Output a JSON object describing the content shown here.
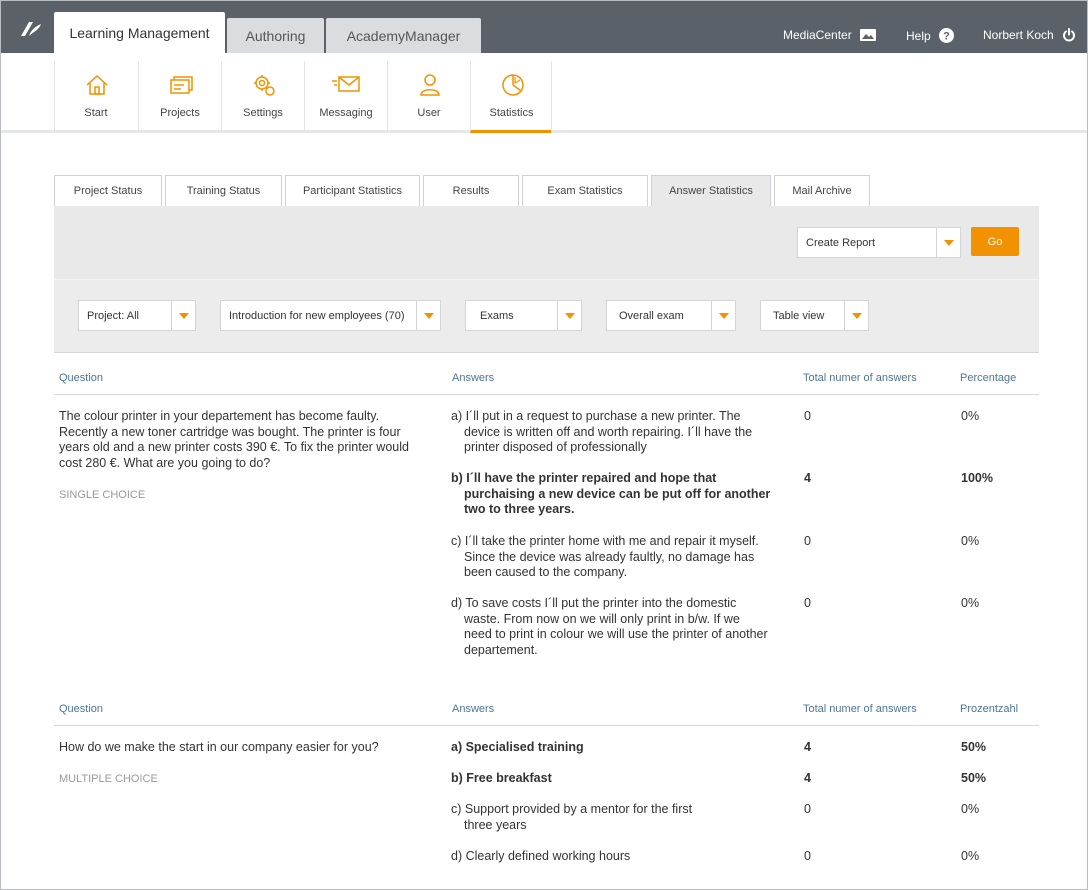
{
  "topbar": {
    "tabs": [
      {
        "label": "Learning Management"
      },
      {
        "label": "Authoring"
      },
      {
        "label": "AcademyManager"
      }
    ],
    "links": {
      "mediacenter": "MediaCenter",
      "help": "Help",
      "user": "Norbert Koch"
    }
  },
  "nav": {
    "items": [
      {
        "label": "Start"
      },
      {
        "label": "Projects"
      },
      {
        "label": "Settings"
      },
      {
        "label": "Messaging"
      },
      {
        "label": "User"
      },
      {
        "label": "Statistics"
      }
    ],
    "accent": "#f39200"
  },
  "subtabs": [
    {
      "label": "Project Status"
    },
    {
      "label": "Training Status"
    },
    {
      "label": "Participant Statistics"
    },
    {
      "label": "Results"
    },
    {
      "label": "Exam Statistics"
    },
    {
      "label": "Answer Statistics"
    },
    {
      "label": "Mail Archive"
    }
  ],
  "report": {
    "select": "Create Report",
    "go": "Go"
  },
  "filters": {
    "project": "Project: All",
    "training": "Introduction for new employees (70)",
    "type": "Exams",
    "exam": "Overall exam",
    "view": "Table view"
  },
  "questions": [
    {
      "headers": {
        "question": "Question",
        "answers": "Answers",
        "total": "Total numer of answers",
        "pct": "Percentage"
      },
      "text": "The colour printer in your departement has become faulty. Recently a new toner cartridge was bought. The printer is four years old and a new printer costs 390 €. To fix the printer would cost 280 €. What are you going to do?",
      "type": "SINGLE CHOICE",
      "answers": [
        {
          "text": "a) I´ll put in a request to purchase a new printer. The device is written off and worth repairing. I´ll have the printer disposed of professionally",
          "count": "0",
          "pct": "0%"
        },
        {
          "text": "b) I´ll have the printer repaired and hope that purchaising a new device can be put off for another two to three years.",
          "count": "4",
          "pct": "100%"
        },
        {
          "text": "c) I´ll take the printer home with me and repair it myself. Since the device was already faultly, no damage has been caused to the company.",
          "count": "0",
          "pct": "0%"
        },
        {
          "text": "d) To save costs I´ll put the printer into the domestic waste. From now on we will only print in b/w. If we need to print in colour we will use the printer of another departement.",
          "count": "0",
          "pct": "0%"
        }
      ]
    },
    {
      "headers": {
        "question": "Question",
        "answers": "Answers",
        "total": "Total numer of answers",
        "pct": "Prozentzahl"
      },
      "text": "How do we make the start in our company easier for you?",
      "type": "MULTIPLE CHOICE",
      "answers": [
        {
          "text": "a) Specialised training",
          "count": "4",
          "pct": "50%"
        },
        {
          "text": "b) Free breakfast",
          "count": "4",
          "pct": "50%"
        },
        {
          "text": "c) Support provided by a mentor for the first three years",
          "count": "0",
          "pct": "0%"
        },
        {
          "text": "d) Clearly defined working hours",
          "count": "0",
          "pct": "0%"
        }
      ]
    }
  ]
}
